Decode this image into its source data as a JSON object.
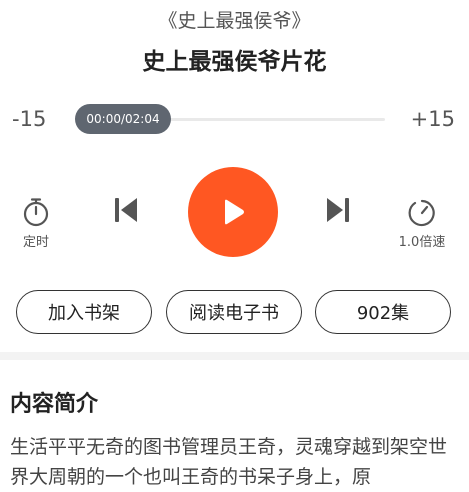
{
  "book_title": "《史上最强侯爷》",
  "track_title": "史上最强侯爷片花",
  "player": {
    "skip_back_label": "-15",
    "skip_forward_label": "+15",
    "time_display": "00:00/02:04",
    "progress_fraction": 0.0,
    "timer_label": "定时",
    "speed_label": "1.0倍速",
    "accent_color": "#ff5722"
  },
  "actions": {
    "add_to_shelf": "加入书架",
    "read_ebook": "阅读电子书",
    "episodes": "902集"
  },
  "intro": {
    "heading": "内容简介",
    "text": "生活平平无奇的图书管理员王奇，灵魂穿越到架空世界大周朝的一个也叫王奇的书呆子身上，原"
  },
  "icons": {
    "timer": "stopwatch-icon",
    "previous": "skip-previous-icon",
    "play": "play-icon",
    "next": "skip-next-icon",
    "speed": "speed-gauge-icon"
  }
}
